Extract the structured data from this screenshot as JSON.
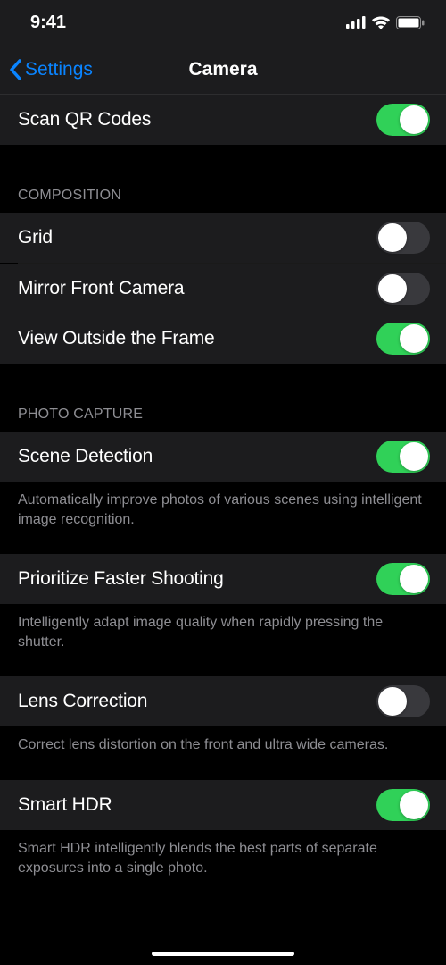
{
  "status": {
    "time": "9:41"
  },
  "nav": {
    "back_label": "Settings",
    "title": "Camera"
  },
  "colors": {
    "accent": "#0a84ff",
    "toggle_on": "#30d158",
    "toggle_off": "#39393d",
    "row_bg": "#1c1c1e",
    "caption": "#8e8e93"
  },
  "rows": {
    "scan_qr": {
      "label": "Scan QR Codes",
      "on": true
    },
    "grid": {
      "label": "Grid",
      "on": false
    },
    "mirror": {
      "label": "Mirror Front Camera",
      "on": false
    },
    "view_outside": {
      "label": "View Outside the Frame",
      "on": true
    },
    "scene_detection": {
      "label": "Scene Detection",
      "on": true,
      "caption": "Automatically improve photos of various scenes using intelligent image recognition."
    },
    "faster_shooting": {
      "label": "Prioritize Faster Shooting",
      "on": true,
      "caption": "Intelligently adapt image quality when rapidly pressing the shutter."
    },
    "lens_correction": {
      "label": "Lens Correction",
      "on": false,
      "caption": "Correct lens distortion on the front and ultra wide cameras."
    },
    "smart_hdr": {
      "label": "Smart HDR",
      "on": true,
      "caption": "Smart HDR intelligently blends the best parts of separate exposures into a single photo."
    }
  },
  "sections": {
    "composition": "COMPOSITION",
    "photo_capture": "PHOTO CAPTURE"
  }
}
